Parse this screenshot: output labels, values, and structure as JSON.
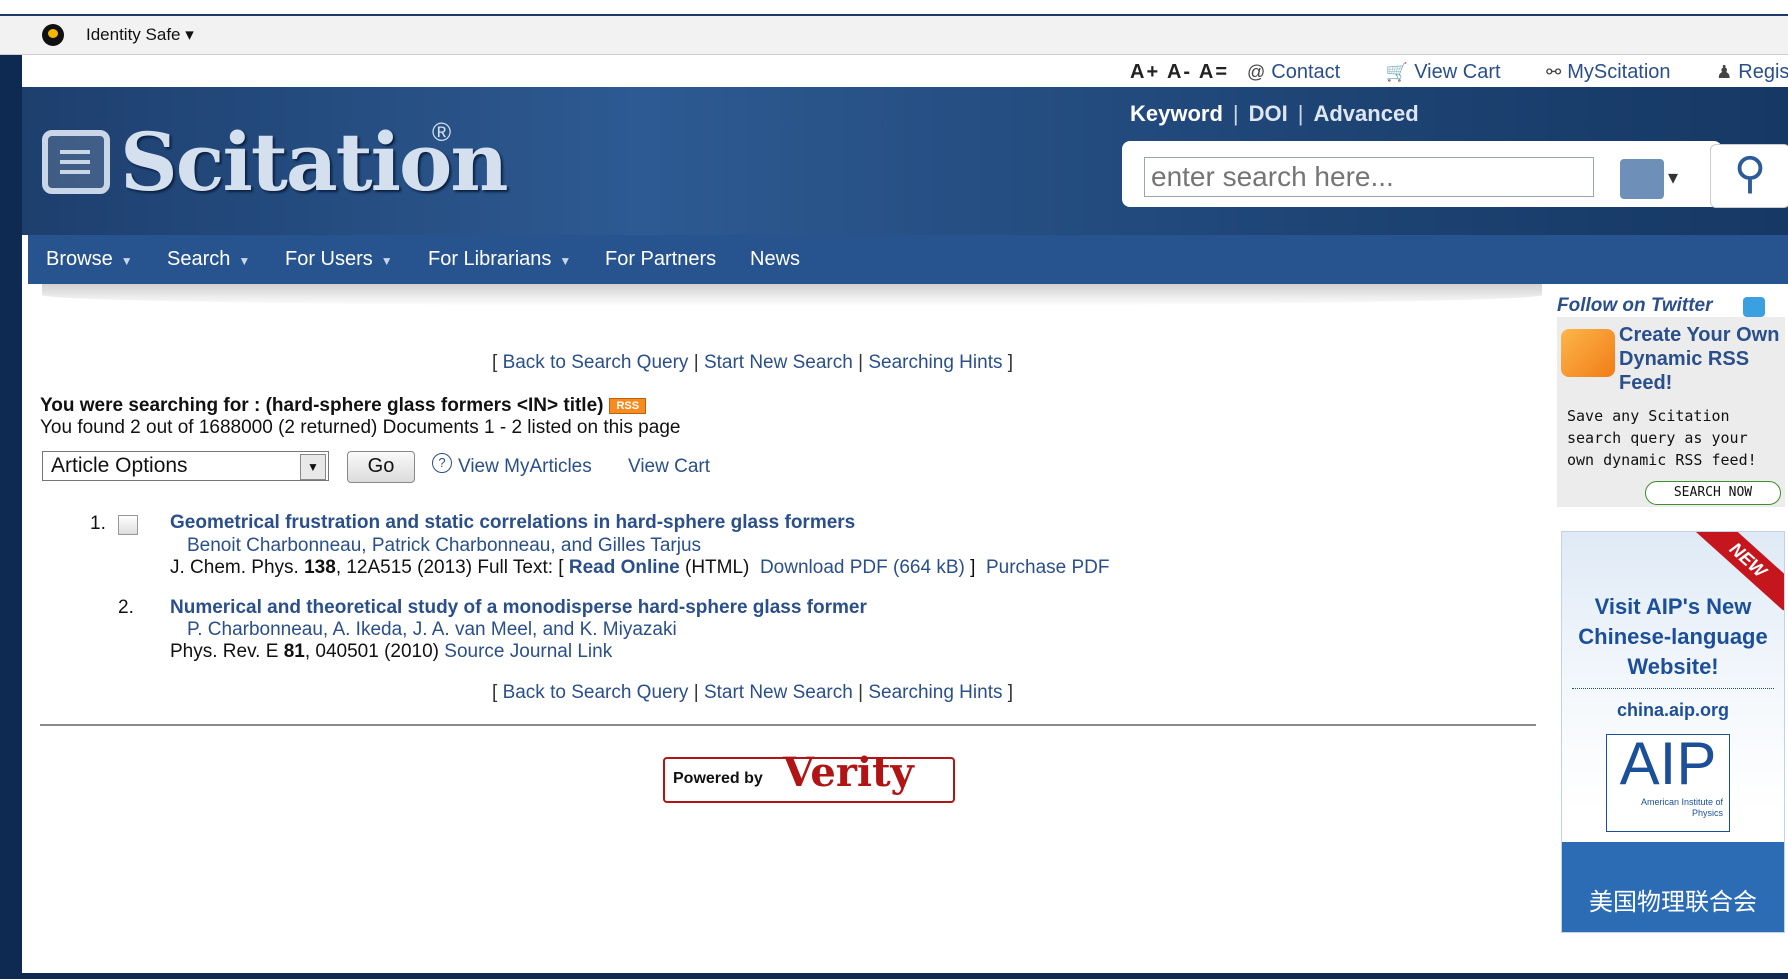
{
  "browser": {
    "identity_safe_label": "Identity Safe ▾"
  },
  "topbar": {
    "font_sizes": [
      "A+",
      "A-",
      "A="
    ],
    "links": [
      {
        "icon": "@",
        "label": "Contact"
      },
      {
        "icon": "🛒",
        "label": "View Cart"
      },
      {
        "icon": "⚯",
        "label": "MyScitation"
      },
      {
        "icon": "♟",
        "label": "Register"
      }
    ]
  },
  "header": {
    "logo_text": "Scitation",
    "logo_reg": "®",
    "search_tabs": [
      "Keyword",
      "DOI",
      "Advanced"
    ],
    "search_placeholder": "enter search here...",
    "search_button_icon": "magnifier-icon"
  },
  "nav": {
    "items": [
      {
        "label": "Browse",
        "caret": true
      },
      {
        "label": "Search",
        "caret": true
      },
      {
        "label": "For Users",
        "caret": true
      },
      {
        "label": "For Librarians",
        "caret": true
      },
      {
        "label": "For Partners",
        "caret": false
      },
      {
        "label": "News",
        "caret": false
      }
    ]
  },
  "links_row": {
    "open": "[",
    "back": "Back to Search Query",
    "new": "Start New Search",
    "hints": "Searching Hints",
    "close": "]",
    "sep": "|"
  },
  "query": {
    "searching_for": "You were searching for : (hard-sphere glass formers <IN> title)",
    "rss_badge": "RSS",
    "found": "You found 2 out of 1688000 (2 returned)   Documents 1 - 2 listed on this page"
  },
  "article_options": {
    "selected": "Article Options",
    "go_label": "Go",
    "help_icon": "?",
    "view_myarticles": "View MyArticles",
    "view_cart": "View Cart"
  },
  "results": [
    {
      "number": "1.",
      "has_checkbox": true,
      "title": "Geometrical frustration and static correlations in hard-sphere glass formers",
      "authors": "Benoit Charbonneau, Patrick Charbonneau, and Gilles Tarjus",
      "journal": "J. Chem. Phys.",
      "volume": "138",
      "rest": ", 12A515 (2013)  Full Text: [ ",
      "read_online": "Read Online",
      "html_suffix": " (HTML)",
      "download": "Download PDF (664 kB)",
      "bracket_close": " ]",
      "purchase": "Purchase PDF"
    },
    {
      "number": "2.",
      "has_checkbox": false,
      "title": "Numerical and theoretical study of a monodisperse hard-sphere glass former",
      "authors": "P. Charbonneau, A. Ikeda, J. A. van Meel, and K. Miyazaki",
      "journal": "Phys. Rev. E",
      "volume": "81",
      "rest": ", 040501 (2010)  ",
      "source_link": "Source Journal Link"
    }
  ],
  "powered_by": {
    "prefix": "Powered by",
    "brand": "Verity"
  },
  "sidebar": {
    "follow_twitter": "Follow on Twitter",
    "rss_heading": "Create Your Own Dynamic RSS Feed!",
    "rss_body": "Save any Scitation search query as your own dynamic RSS feed!",
    "rss_button": "SEARCH NOW",
    "aip_new": "NEW",
    "aip_visit": "Visit AIP's New Chinese-language Website!",
    "aip_url": "china.aip.org",
    "aip_logo": "AIP",
    "aip_logo_sub": "American Institute of Physics",
    "aip_cn": "美国物理联合会"
  },
  "colors": {
    "link": "#2a4f8a",
    "nav_bg": "#27548f",
    "header_bg": "#1d3f6e",
    "rss_orange": "#f68b1f"
  }
}
